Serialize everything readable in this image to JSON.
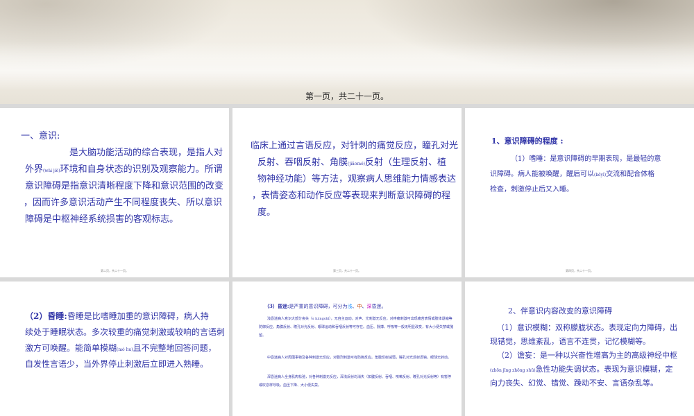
{
  "cover": {
    "caption": "第一页，共二十一页。"
  },
  "slides": [
    {
      "heading": "一、意识:",
      "line1": "是大脑功能活动的综合表现，是指人对",
      "line2a": "外界",
      "ruby1": "(wài jiè)",
      "line2b": "环境和自身状态的识别及观察能力。所谓",
      "line3": "意识障碍是指意识清晰程度下降和意识范围的改变",
      "line4": "，因而许多意识活动产生不同程度丧失、所以意识",
      "line5": "障碍是中枢神经系统损害的客观标志。",
      "footer": "第二页，共二十一页。"
    },
    {
      "line1": "临床上通过言语反应，对针刺的痛觉反应，瞳孔对光",
      "line2": "反射、吞咽反射、角膜",
      "ruby1": "(jiǎomó)",
      "line2b": "反射（生理反射、植",
      "line3": "物神经功能）等方法，观察病人思维能力情感表达",
      "line4": "，表情姿态和动作反应等表现来判断意识障碍的程",
      "line5": "度。",
      "footer": "第三页，共二十一页。"
    },
    {
      "heading": "1、意识障碍的程度 :",
      "line1": "（1）嗜睡：是意识障碍的早期表现，是最轻的意",
      "line2": "识障碍。病人能被唤醒，醒后可以",
      "ruby1": "(kěyǐ)",
      "line2b": "交流和配合体格",
      "line3": "检查，刺激停止后又入睡。",
      "footer": "第四页，共二十一页。"
    },
    {
      "heading": "（2）昏睡:",
      "line1": "昏睡是比嗜睡加重的意识障碍，病人持",
      "line2": "续处于睡眠状态。多次较重的痛觉刺激或较响的言语刺",
      "line3": "激方可唤醒。能简单模糊",
      "ruby1": "(mó hu)",
      "line3b": "且不完整地回答问题，",
      "line4": "自发性言语少，当外界停止刺激后立即进入熟睡。",
      "footer": "第五页，共二十一页。"
    },
    {
      "heading": "（3）昏迷:",
      "headtail": "是严重的意识障碍，可分为",
      "q": "浅",
      "z": "中",
      "s": "深",
      "headend": "昏迷。",
      "p1": "浅昏迷病人意识大部分丧失（s hàngshī），无自主运动，对声、光刺激无反应，对疼痛刺激可出现痛苦表情或肢体退缩等防御反应。角膜反射、瞳孔对光反射、眼球运动和吞咽反射等可存在。血压、脉搏、呼吸等一般无明显改变，有大小便失禁或潴留。",
      "p2": "中昏迷病人对周围事物及各种刺激无反应，对剧烈刺激可有防御反应。角膜反射减弱，瞳孔对光反射迟钝，眼球无转动。",
      "p3": "深昏迷病人全身肌肉松弛，对各种刺激无反应，深浅反射均消失（如腱反射、吞咽、咳嗽反射、瞳孔对光反射等）有暂停或叹息样呼吸，血压下降、大小便失禁。"
    },
    {
      "heading": "2、伴意识内容改变的意识障碍",
      "line1": "（1）意识模糊：双称朦胧状态。表现定向力障碍，出",
      "line2": "现错觉，思维紊乱，语言不连贯，记忆模糊等。",
      "line3": "（2）谵妄：是一种以兴奋性增高为主的高级神经中枢",
      "ruby1": "(zhōn jīng zhōng shū)",
      "line4": "急性功能失调状态。表现为意识模糊，定",
      "line5": "向力丧失、幻觉、错觉、躁动不安、言语杂乱等。"
    }
  ]
}
